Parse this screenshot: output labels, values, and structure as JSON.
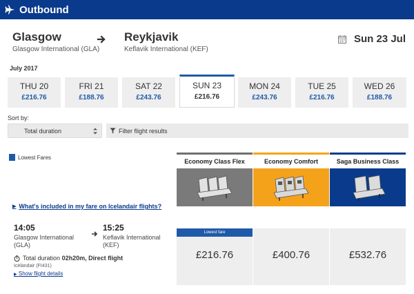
{
  "header": {
    "title": "Outbound",
    "icon": "plane-icon"
  },
  "route": {
    "from": {
      "city": "Glasgow",
      "airport": "Glasgow International (GLA)"
    },
    "to": {
      "city": "Reykjavik",
      "airport": "Keflavik International (KEF)"
    },
    "date": "Sun 23 Jul"
  },
  "month": "July 2017",
  "days": [
    {
      "name": "THU 20",
      "price": "£216.76"
    },
    {
      "name": "FRI 21",
      "price": "£188.76"
    },
    {
      "name": "SAT 22",
      "price": "£243.76"
    },
    {
      "name": "SUN 23",
      "price": "£216.76"
    },
    {
      "name": "MON 24",
      "price": "£243.76"
    },
    {
      "name": "TUE 25",
      "price": "£216.76"
    },
    {
      "name": "WED 26",
      "price": "£188.76"
    }
  ],
  "selected_day": "SUN 23",
  "sort": {
    "label": "Sort by:",
    "value": "Total duration"
  },
  "filter": {
    "label": "Filter flight results"
  },
  "legend": {
    "label": "Lowest Fares"
  },
  "fare_classes": [
    {
      "name": "Economy Class Flex",
      "accent": "#6f6f6f",
      "image_bg": "#7a7a7a"
    },
    {
      "name": "Economy Comfort",
      "accent": "#f5a21b",
      "image_bg": "#f5a21b"
    },
    {
      "name": "Saga Business Class",
      "accent": "#0a3a8c",
      "image_bg": "#0a3a8c"
    }
  ],
  "included_link": "What's included in my fare on Icelandair flights?",
  "flight": {
    "depart_time": "14:05",
    "depart_airport_line1": "Glasgow International",
    "depart_airport_line2": "(GLA)",
    "arrive_time": "15:25",
    "arrive_airport_line1": "Keflavik International",
    "arrive_airport_line2": "(KEF)",
    "duration_prefix": "Total duration",
    "duration": "02h20m",
    "duration_suffix": ", Direct flight",
    "airline": "Icelandair (FI431)",
    "details_link": "Show flight details"
  },
  "fares": [
    {
      "badge": "Lowest fare",
      "price": "£216.76"
    },
    {
      "badge": "",
      "price": "£400.76"
    },
    {
      "badge": "",
      "price": "£532.76"
    }
  ],
  "colors": {
    "brand": "#0a3a8c",
    "accent": "#1f5aa8",
    "tile": "#eeeeee"
  }
}
